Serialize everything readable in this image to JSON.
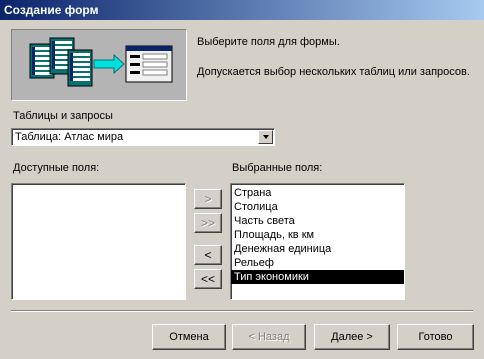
{
  "window": {
    "title": "Создание форм"
  },
  "intro": {
    "line1": "Выберите поля для формы.",
    "line2": "Допускается выбор нескольких таблиц или запросов."
  },
  "source": {
    "label": "Таблицы и запросы",
    "selected": "Таблица: Атлас мира"
  },
  "available": {
    "label": "Доступные поля:",
    "items": []
  },
  "selected_fields": {
    "label": "Выбранные поля:",
    "items": [
      "Страна",
      "Столица",
      "Часть света",
      "Площадь, кв км",
      "Денежная единица",
      "Рельеф",
      "Тип экономики"
    ],
    "selected_item": "Тип экономики"
  },
  "move_buttons": {
    "add_one": ">",
    "add_all": ">>",
    "remove_one": "<",
    "remove_all": "<<"
  },
  "footer": {
    "cancel": "Отмена",
    "back": "< Назад",
    "next": "Далее >",
    "finish": "Готово"
  },
  "colors": {
    "title_start": "#0a246a",
    "title_end": "#a6caf0",
    "dialog_bg": "#d4d0c8",
    "selection": "#000000",
    "arrow": "#00e0e0"
  }
}
